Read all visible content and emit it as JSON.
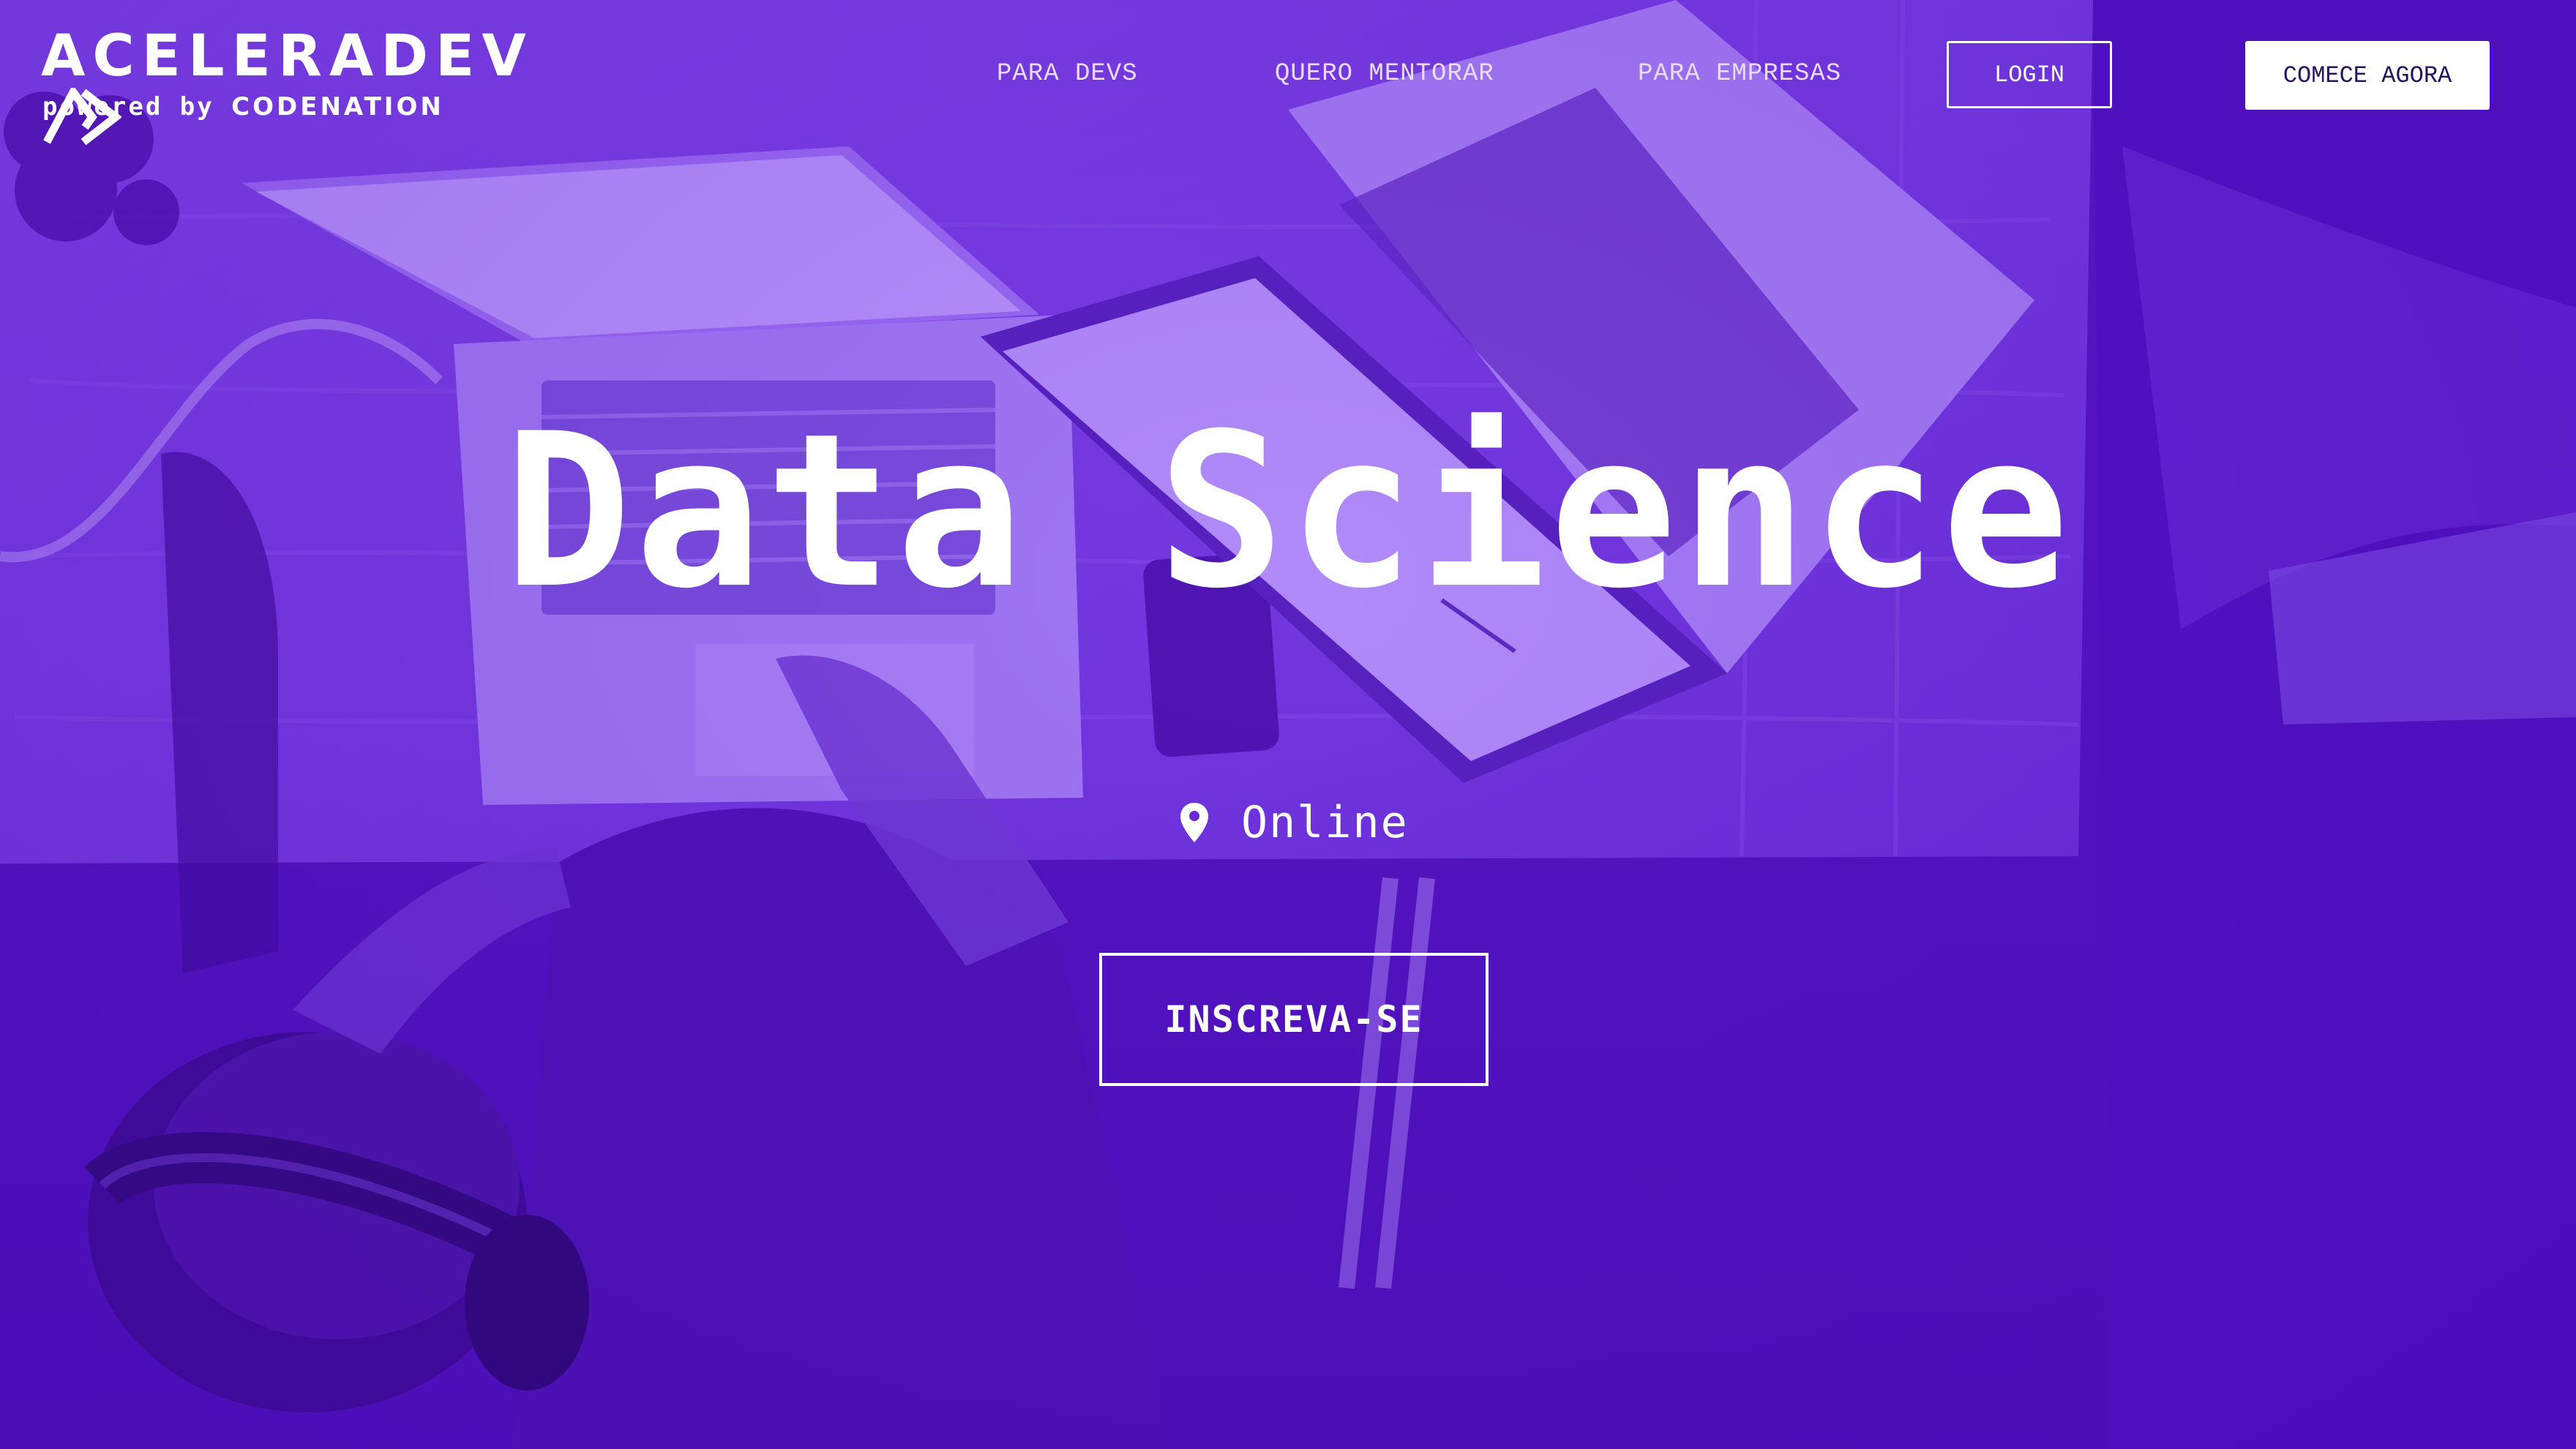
{
  "brand": {
    "wordmark": "ACELERADEV",
    "powered_prefix": "powered by ",
    "powered_brand": "CODENATION"
  },
  "nav": {
    "items": [
      {
        "label": "PARA DEVS"
      },
      {
        "label": "QUERO MENTORAR"
      },
      {
        "label": "PARA EMPRESAS"
      }
    ],
    "login_label": "LOGIN",
    "start_label": "COMECE AGORA"
  },
  "hero": {
    "title": "Data Science",
    "location": "Online",
    "cta_label": "INSCREVA-SE"
  },
  "colors": {
    "background": "#6224d6",
    "text": "#ffffff",
    "start_button_text": "#2a1160"
  },
  "icons": {
    "location": "map-pin-icon",
    "logo_mark": "double-chevron-icon"
  }
}
